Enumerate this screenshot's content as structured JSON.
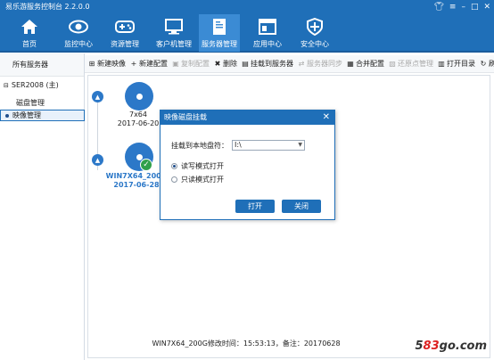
{
  "app": {
    "title": "易乐游服务控制台 2.2.0.0"
  },
  "nav": {
    "items": [
      {
        "label": "首页",
        "icon": "home-icon"
      },
      {
        "label": "监控中心",
        "icon": "eye-icon"
      },
      {
        "label": "资源管理",
        "icon": "gamepad-icon"
      },
      {
        "label": "客户机管理",
        "icon": "monitor-icon"
      },
      {
        "label": "服务器管理",
        "icon": "server-doc-icon"
      },
      {
        "label": "应用中心",
        "icon": "app-window-icon"
      },
      {
        "label": "安全中心",
        "icon": "shield-icon"
      }
    ],
    "active": "服务器管理",
    "active_color": "#3b8bd4",
    "brand_color": "#1f6fb8"
  },
  "sidebar": {
    "header": "所有服务器",
    "server": "SER2008 (主)",
    "disk_mgmt": "磁盘管理",
    "image_mgmt": "映像管理"
  },
  "toolbar": {
    "new_image": "新建映像",
    "new_config": "新建配置",
    "copy_config": "复制配置",
    "delete": "删除",
    "mount_server": "挂载到服务器",
    "server_sync": "服务器同步",
    "merge_config": "合并配置",
    "restore_manage": "还原点管理",
    "open_dir": "打开目录",
    "refresh": "刷新"
  },
  "images": [
    {
      "name": "7x64",
      "date": "2017-06-20",
      "selected": false
    },
    {
      "name": "WIN7X64_200G",
      "date": "2017-06-28",
      "selected": true
    }
  ],
  "status": {
    "text": "WIN7X64_200G修改时间：15:53:13，备注：20170628"
  },
  "dialog": {
    "title": "映像磁盘挂载",
    "drive_label": "挂载到本地盘符：",
    "drive_value": "I:\\",
    "option_rw": "读写模式打开",
    "option_ro": "只读模式打开",
    "selected_option": "读写模式打开",
    "open_button": "打开",
    "close_button": "关闭"
  },
  "watermark": {
    "prefix": "5",
    "num": "83",
    "suffix": "go.com"
  }
}
